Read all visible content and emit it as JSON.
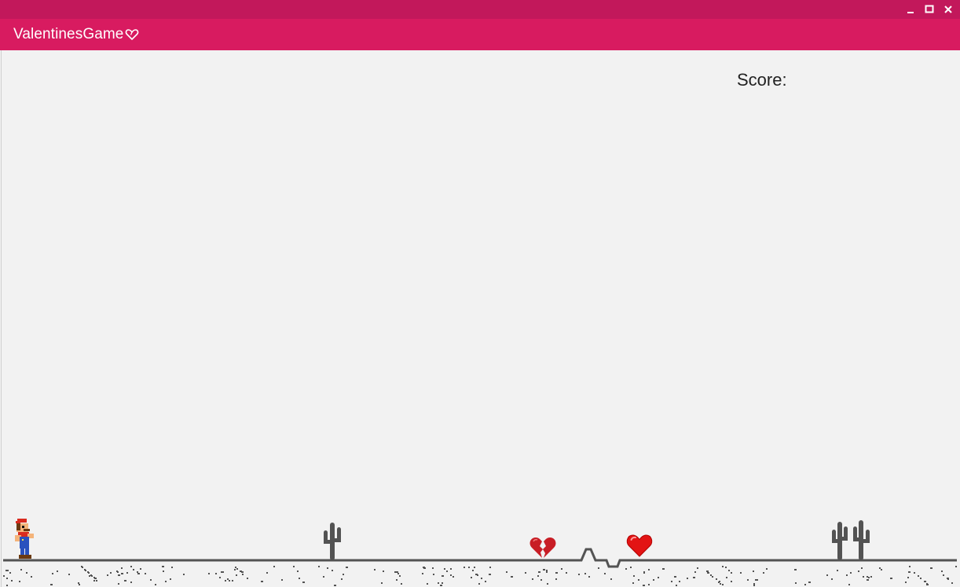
{
  "window": {
    "title": "ValentinesGame",
    "controls": [
      "minimize",
      "maximize",
      "close"
    ]
  },
  "hud": {
    "score_label": "Score:"
  },
  "colors": {
    "titlebar": "#c2185b",
    "appbar": "#d81b60",
    "background": "#f2f2f2",
    "ground": "#535353",
    "heart": "#e01010"
  },
  "sprites": [
    {
      "name": "player-mario",
      "icon": "mario-sprite"
    },
    {
      "name": "cactus-single",
      "icon": "cactus-icon"
    },
    {
      "name": "broken-heart",
      "icon": "broken-heart-icon"
    },
    {
      "name": "heart",
      "icon": "heart-icon"
    },
    {
      "name": "cactus-double",
      "icon": "cactus-double-icon"
    }
  ]
}
